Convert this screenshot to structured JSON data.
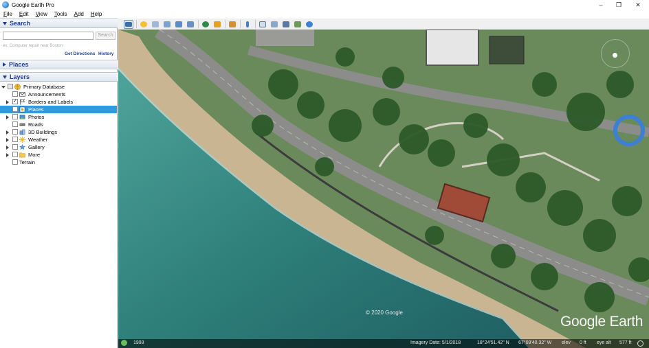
{
  "window": {
    "title": "Google Earth Pro",
    "minimize": "–",
    "maximize": "❐",
    "close": "✕"
  },
  "menu": [
    "File",
    "Edit",
    "View",
    "Tools",
    "Add",
    "Help"
  ],
  "search": {
    "header": "Search",
    "placeholder": "",
    "button": "Search",
    "hint": "ex: Computer repair near Boston",
    "get_directions": "Get Directions",
    "history": "History"
  },
  "places": {
    "header": "Places"
  },
  "layers": {
    "header": "Layers",
    "items": [
      {
        "label": "Primary Database",
        "icon": "database-icon",
        "checked": false,
        "expanded": true
      },
      {
        "label": "Announcements",
        "icon": "envelope-icon",
        "checked": false
      },
      {
        "label": "Borders and Labels",
        "icon": "flag-icon",
        "checked": true
      },
      {
        "label": "Places",
        "icon": "places-icon",
        "checked": false,
        "selected": true
      },
      {
        "label": "Photos",
        "icon": "photo-icon",
        "checked": false
      },
      {
        "label": "Roads",
        "icon": "road-icon",
        "checked": false
      },
      {
        "label": "3D Buildings",
        "icon": "building-icon",
        "checked": false
      },
      {
        "label": "Weather",
        "icon": "sun-icon",
        "checked": false
      },
      {
        "label": "Gallery",
        "icon": "star-icon",
        "checked": false
      },
      {
        "label": "More",
        "icon": "folder-icon",
        "checked": false
      },
      {
        "label": "Terrain",
        "icon": "",
        "checked": false
      }
    ]
  },
  "map": {
    "copyright": "© 2020 Google",
    "logo": "Google Earth",
    "year": "1993",
    "imagery_date": "Imagery Date: 5/1/2018",
    "lat": "18°24'51.42\" N",
    "lon": "67°09'40.32\" W",
    "elev": "elev",
    "elev_value": "0 ft",
    "eye_alt": "eye alt",
    "eye_alt_value": "577 ft"
  }
}
